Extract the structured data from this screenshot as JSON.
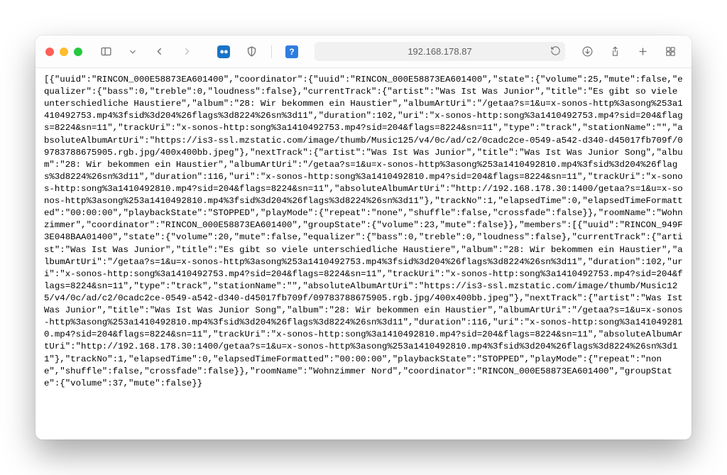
{
  "address": "192.168.178.87",
  "body_text": "[{\"uuid\":\"RINCON_000E58873EA601400\",\"coordinator\":{\"uuid\":\"RINCON_000E58873EA601400\",\"state\":{\"volume\":25,\"mute\":false,\"equalizer\":{\"bass\":0,\"treble\":0,\"loudness\":false},\"currentTrack\":{\"artist\":\"Was Ist Was Junior\",\"title\":\"Es gibt so viele unterschiedliche Haustiere\",\"album\":\"28: Wir bekommen ein Haustier\",\"albumArtUri\":\"/getaa?s=1&u=x-sonos-http%3asong%253a1410492753.mp4%3fsid%3d204%26flags%3d8224%26sn%3d11\",\"duration\":102,\"uri\":\"x-sonos-http:song%3a1410492753.mp4?sid=204&flags=8224&sn=11\",\"trackUri\":\"x-sonos-http:song%3a1410492753.mp4?sid=204&flags=8224&sn=11\",\"type\":\"track\",\"stationName\":\"\",\"absoluteAlbumArtUri\":\"https://is3-ssl.mzstatic.com/image/thumb/Music125/v4/0c/ad/c2/0cadc2ce-0549-a542-d340-d45017fb709f/09783788675905.rgb.jpg/400x400bb.jpeg\"},\"nextTrack\":{\"artist\":\"Was Ist Was Junior\",\"title\":\"Was Ist Was Junior Song\",\"album\":\"28: Wir bekommen ein Haustier\",\"albumArtUri\":\"/getaa?s=1&u=x-sonos-http%3asong%253a1410492810.mp4%3fsid%3d204%26flags%3d8224%26sn%3d11\",\"duration\":116,\"uri\":\"x-sonos-http:song%3a1410492810.mp4?sid=204&flags=8224&sn=11\",\"trackUri\":\"x-sonos-http:song%3a1410492810.mp4?sid=204&flags=8224&sn=11\",\"absoluteAlbumArtUri\":\"http://192.168.178.30:1400/getaa?s=1&u=x-sonos-http%3asong%253a1410492810.mp4%3fsid%3d204%26flags%3d8224%26sn%3d11\"},\"trackNo\":1,\"elapsedTime\":0,\"elapsedTimeFormatted\":\"00:00:00\",\"playbackState\":\"STOPPED\",\"playMode\":{\"repeat\":\"none\",\"shuffle\":false,\"crossfade\":false}},\"roomName\":\"Wohnzimmer\",\"coordinator\":\"RINCON_000E58873EA601400\",\"groupState\":{\"volume\":23,\"mute\":false}},\"members\":[{\"uuid\":\"RINCON_949F3E048BAA01400\",\"state\":{\"volume\":20,\"mute\":false,\"equalizer\":{\"bass\":0,\"treble\":0,\"loudness\":false},\"currentTrack\":{\"artist\":\"Was Ist Was Junior\",\"title\":\"Es gibt so viele unterschiedliche Haustiere\",\"album\":\"28: Wir bekommen ein Haustier\",\"albumArtUri\":\"/getaa?s=1&u=x-sonos-http%3asong%253a1410492753.mp4%3fsid%3d204%26flags%3d8224%26sn%3d11\",\"duration\":102,\"uri\":\"x-sonos-http:song%3a1410492753.mp4?sid=204&flags=8224&sn=11\",\"trackUri\":\"x-sonos-http:song%3a1410492753.mp4?sid=204&flags=8224&sn=11\",\"type\":\"track\",\"stationName\":\"\",\"absoluteAlbumArtUri\":\"https://is3-ssl.mzstatic.com/image/thumb/Music125/v4/0c/ad/c2/0cadc2ce-0549-a542-d340-d45017fb709f/09783788675905.rgb.jpg/400x400bb.jpeg\"},\"nextTrack\":{\"artist\":\"Was Ist Was Junior\",\"title\":\"Was Ist Was Junior Song\",\"album\":\"28: Wir bekommen ein Haustier\",\"albumArtUri\":\"/getaa?s=1&u=x-sonos-http%3asong%253a1410492810.mp4%3fsid%3d204%26flags%3d8224%26sn%3d11\",\"duration\":116,\"uri\":\"x-sonos-http:song%3a1410492810.mp4?sid=204&flags=8224&sn=11\",\"trackUri\":\"x-sonos-http:song%3a1410492810.mp4?sid=204&flags=8224&sn=11\",\"absoluteAlbumArtUri\":\"http://192.168.178.30:1400/getaa?s=1&u=x-sonos-http%3asong%253a1410492810.mp4%3fsid%3d204%26flags%3d8224%26sn%3d11\"},\"trackNo\":1,\"elapsedTime\":0,\"elapsedTimeFormatted\":\"00:00:00\",\"playbackState\":\"STOPPED\",\"playMode\":{\"repeat\":\"none\",\"shuffle\":false,\"crossfade\":false}},\"roomName\":\"Wohnzimmer Nord\",\"coordinator\":\"RINCON_000E58873EA601400\",\"groupState\":{\"volume\":37,\"mute\":false}}",
  "onepass_glyph": "●●",
  "help_glyph": "?"
}
